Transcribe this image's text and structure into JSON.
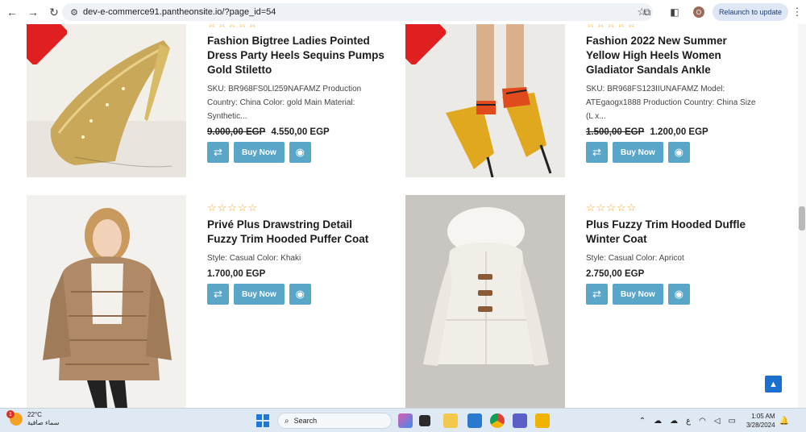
{
  "browser": {
    "url": "dev-e-commerce91.pantheonsite.io/?page_id=54",
    "relaunch_label": "Relaunch to update",
    "profile_initial": "O"
  },
  "products": [
    {
      "title": "Fashion Bigtree Ladies Pointed Dress Party Heels Sequins Pumps Gold Stiletto",
      "description": "SKU: BR968FS0LI259NAFAMZ Production Country: China Color: gold Main Material: Synthetic...",
      "old_price": "9.000,00 EGP",
      "price": "4.550,00 EGP",
      "buy_label": "Buy Now",
      "rating_stars": "☆☆☆☆☆",
      "image": "gold-glitter-stiletto"
    },
    {
      "title": "Fashion 2022 New Summer Yellow High Heels Women Gladiator Sandals Ankle",
      "description": "SKU: BR968FS123IIUNAFAMZ Model: ATEgaogx1888 Production Country: China Size (L x...",
      "old_price": "1.500,00 EGP",
      "price": "1.200,00 EGP",
      "buy_label": "Buy Now",
      "rating_stars": "☆☆☆☆☆",
      "image": "yellow-gladiator-heels"
    },
    {
      "title": "Privé Plus Drawstring Detail Fuzzy Trim Hooded Puffer Coat",
      "description": "Style: Casual Color: Khaki",
      "old_price": "",
      "price": "1.700,00 EGP",
      "buy_label": "Buy Now",
      "rating_stars": "☆☆☆☆☆",
      "image": "khaki-puffer-coat"
    },
    {
      "title": "Plus Fuzzy Trim Hooded Duffle Winter Coat",
      "description": "Style: Casual Color: Apricot",
      "old_price": "",
      "price": "2.750,00 EGP",
      "buy_label": "Buy Now",
      "rating_stars": "☆☆☆☆☆",
      "image": "apricot-duffle-coat"
    }
  ],
  "taskbar": {
    "weather_temp": "22°C",
    "weather_desc": "سماء صافية",
    "weather_badge": "1",
    "search_placeholder": "Search",
    "lang": "ع",
    "time": "1:05 AM",
    "date": "3/28/2024"
  },
  "colors": {
    "button": "#5aa6c9",
    "star": "#f5a623",
    "sale": "#e02020"
  }
}
